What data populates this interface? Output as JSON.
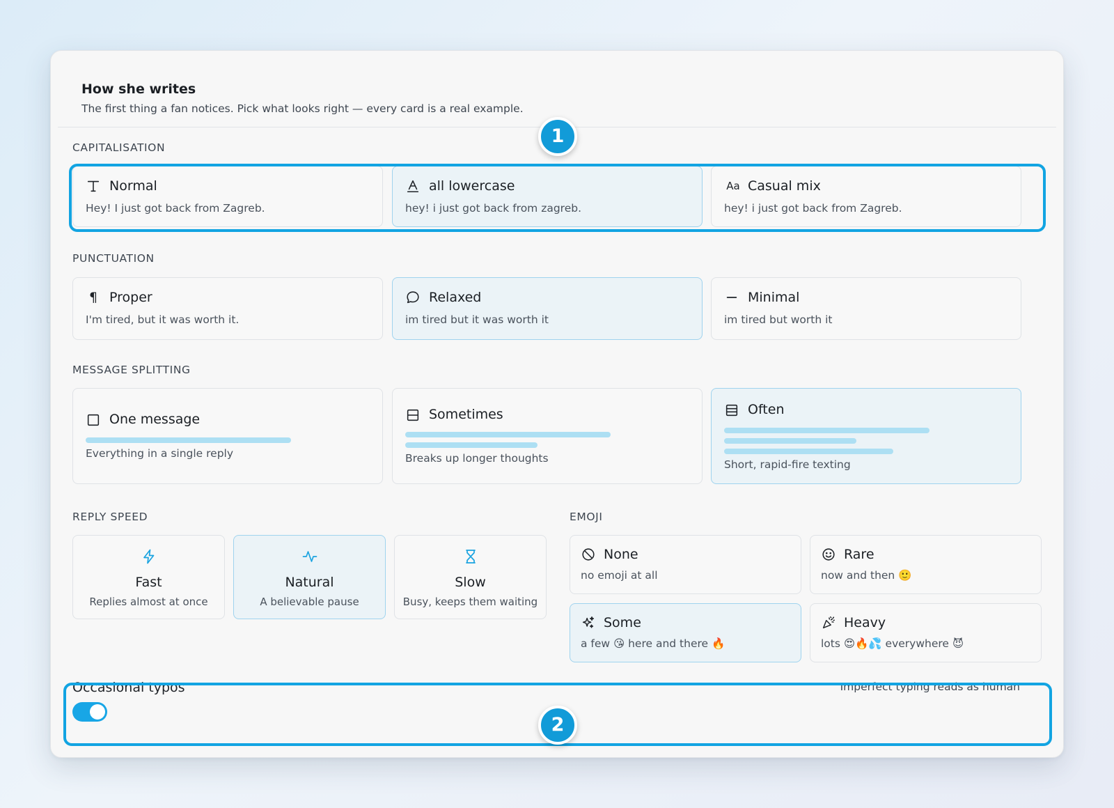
{
  "header": {
    "title": "How she writes",
    "subtitle": "The first thing a fan notices. Pick what looks right — every card is a real example."
  },
  "capitalisation": {
    "label": "CAPITALISATION",
    "options": [
      {
        "title": "Normal",
        "example": "Hey! I just got back from Zagreb.",
        "icon": "text-t-icon",
        "selected": false
      },
      {
        "title": "all lowercase",
        "example": "hey! i just got back from zagreb.",
        "icon": "text-a-icon",
        "selected": true
      },
      {
        "title": "Casual mix",
        "example": "hey! i just got back from Zagreb.",
        "icon": "case-aa-icon",
        "icon_text": "Aa",
        "selected": false
      }
    ]
  },
  "punctuation": {
    "label": "PUNCTUATION",
    "options": [
      {
        "title": "Proper",
        "example": "I'm tired, but it was worth it.",
        "icon": "pilcrow-icon",
        "icon_text": "¶",
        "selected": false
      },
      {
        "title": "Relaxed",
        "example": "im tired but it was worth it",
        "icon": "speech-bubble-icon",
        "selected": true
      },
      {
        "title": "Minimal",
        "example": "im tired but worth it",
        "icon": "dash-icon",
        "selected": false
      }
    ]
  },
  "splitting": {
    "label": "MESSAGE SPLITTING",
    "options": [
      {
        "title": "One message",
        "example": "Everything in a single reply",
        "icon": "square-icon",
        "selected": false
      },
      {
        "title": "Sometimes",
        "example": "Breaks up longer thoughts",
        "icon": "split-two-icon",
        "selected": false
      },
      {
        "title": "Often",
        "example": "Short, rapid-fire texting",
        "icon": "split-three-icon",
        "selected": true
      }
    ]
  },
  "reply_speed": {
    "label": "REPLY SPEED",
    "options": [
      {
        "title": "Fast",
        "example": "Replies almost at once",
        "icon": "lightning-icon",
        "selected": false
      },
      {
        "title": "Natural",
        "example": "A believable pause",
        "icon": "pulse-icon",
        "selected": true
      },
      {
        "title": "Slow",
        "example": "Busy, keeps them waiting",
        "icon": "hourglass-icon",
        "selected": false
      }
    ]
  },
  "emoji": {
    "label": "EMOJI",
    "options": [
      {
        "title": "None",
        "example": "no emoji at all",
        "icon": "no-symbol-icon",
        "selected": false
      },
      {
        "title": "Rare",
        "example": "now and then 🙂",
        "icon": "smiley-icon",
        "selected": false
      },
      {
        "title": "Some",
        "example": "a few 😘 here and there 🔥",
        "icon": "sparkles-icon",
        "selected": true
      },
      {
        "title": "Heavy",
        "example": "lots 😍🔥💦 everywhere 😈",
        "icon": "party-popper-icon",
        "selected": false
      }
    ]
  },
  "typos": {
    "label": "Occasional typos",
    "hint": "Imperfect typing reads as human",
    "enabled": true
  },
  "annotations": {
    "badge_1": "1",
    "badge_2": "2"
  },
  "colors": {
    "accent": "#12a4e2",
    "selected_bg": "#ebf3f7",
    "selected_border": "#9fd3ee",
    "bar": "#addff3"
  }
}
